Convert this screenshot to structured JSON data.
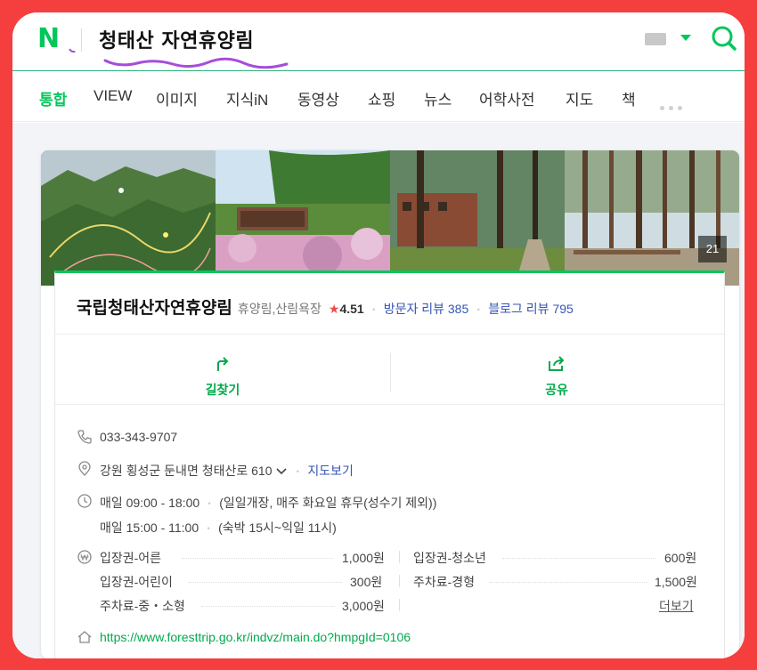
{
  "header": {
    "logo": "N",
    "query": "청태산 자연휴양림",
    "colors": {
      "brand": "#03c75a",
      "frame": "#f53f3f",
      "link": "#3556b4"
    }
  },
  "tabs": [
    {
      "label": "통합",
      "active": true
    },
    {
      "label": "VIEW",
      "active": false
    },
    {
      "label": "이미지",
      "active": false
    },
    {
      "label": "지식iN",
      "active": false
    },
    {
      "label": "동영상",
      "active": false
    },
    {
      "label": "쇼핑",
      "active": false
    },
    {
      "label": "뉴스",
      "active": false
    },
    {
      "label": "어학사전",
      "active": false
    },
    {
      "label": "지도",
      "active": false
    },
    {
      "label": "책",
      "active": false
    }
  ],
  "photos": {
    "count": "21"
  },
  "place": {
    "name": "국립청태산자연휴양림",
    "category": "휴양림,산림욕장",
    "rating": "4.51",
    "visitor_reviews": "방문자 리뷰 385",
    "blog_reviews": "블로그 리뷰 795"
  },
  "actions": {
    "directions": "길찾기",
    "share": "공유"
  },
  "info": {
    "phone": "033-343-9707",
    "address": "강원 횡성군 둔내면 청태산로 610",
    "map_link": "지도보기",
    "hours1_time": "매일 09:00 - 18:00",
    "hours1_note": "(일일개장, 매주 화요일 휴무(성수기 제외))",
    "hours2_time": "매일 15:00 - 11:00",
    "hours2_note": "(숙박 15시~익일 11시)",
    "url": "https://www.foresttrip.go.kr/indvz/main.do?hmpgId=0106"
  },
  "prices": [
    {
      "label": "입장권-어른",
      "value": "1,000원"
    },
    {
      "label": "입장권-청소년",
      "value": "600원"
    },
    {
      "label": "입장권-어린이",
      "value": "300원"
    },
    {
      "label": "주차료-경형",
      "value": "1,500원"
    },
    {
      "label": "주차료-중・소형",
      "value": "3,000원"
    }
  ],
  "more_label": "더보기"
}
